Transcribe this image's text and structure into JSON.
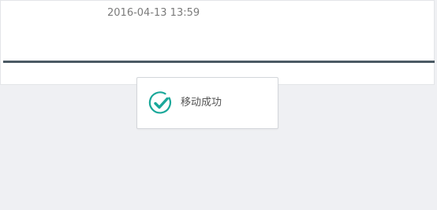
{
  "record": {
    "timestamp": "2016-04-13 13:59"
  },
  "toast": {
    "message": "移动成功",
    "icon": "success-check-icon",
    "accent_color": "#1aa89a"
  }
}
